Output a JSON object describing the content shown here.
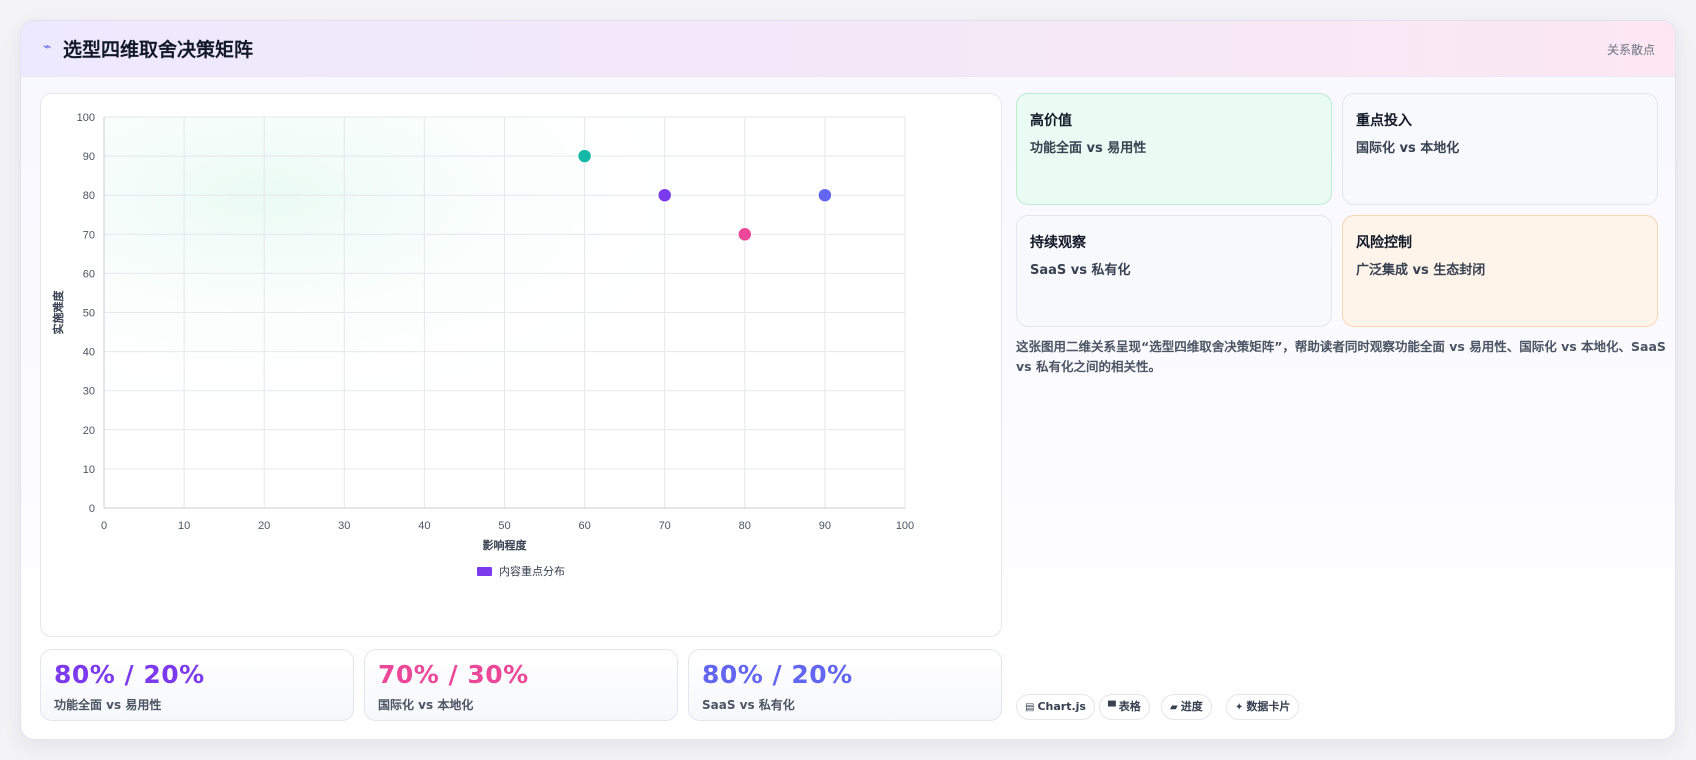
{
  "header": {
    "icon": "lightning-icon",
    "icon_glyph": "⌁",
    "title": "选型四维取舍决策矩阵",
    "tag": "关系散点"
  },
  "chart_data": {
    "type": "scatter",
    "xlabel": "影响程度",
    "ylabel": "实施难度",
    "xlim": [
      0,
      100
    ],
    "ylim": [
      0,
      100
    ],
    "xticks": [
      0,
      10,
      20,
      30,
      40,
      50,
      60,
      70,
      80,
      90,
      100
    ],
    "yticks": [
      0,
      10,
      20,
      30,
      40,
      50,
      60,
      70,
      80,
      90,
      100
    ],
    "grid": true,
    "legend": {
      "position": "bottom",
      "label": "内容重点分布",
      "color": "#7c3aed"
    },
    "series": [
      {
        "name": "内容重点分布",
        "points": [
          {
            "x": 60,
            "y": 90,
            "color": "#14b8a6"
          },
          {
            "x": 70,
            "y": 80,
            "color": "#7c3aed"
          },
          {
            "x": 80,
            "y": 70,
            "color": "#ec4899"
          },
          {
            "x": 90,
            "y": 80,
            "color": "#6366f1"
          }
        ]
      }
    ]
  },
  "stats": [
    {
      "value": "80% / 20%",
      "label": "功能全面 vs 易用性",
      "color": "#7c3aed"
    },
    {
      "value": "70% / 30%",
      "label": "国际化 vs 本地化",
      "color": "#ec4899"
    },
    {
      "value": "80% / 20%",
      "label": "SaaS vs 私有化",
      "color": "#6366f1"
    }
  ],
  "quadrants": [
    {
      "title": "高价值",
      "subtitle": "功能全面 vs 易用性",
      "bg": "#e9fbf2",
      "border": "#bdebd3"
    },
    {
      "title": "重点投入",
      "subtitle": "国际化 vs 本地化",
      "bg": "#f8f9fc",
      "border": "#e3e6ef"
    },
    {
      "title": "持续观察",
      "subtitle": "SaaS vs 私有化",
      "bg": "#f8f9fc",
      "border": "#e3e6ef"
    },
    {
      "title": "风险控制",
      "subtitle": "广泛集成 vs 生态封闭",
      "bg": "#fff4ea",
      "border": "#f5d6b4"
    }
  ],
  "description": "这张图用二维关系呈现“选型四维取舍决策矩阵”，帮助读者同时观察功能全面 vs 易用性、国际化 vs 本地化、SaaS vs 私有化之间的相关性。",
  "chips": [
    {
      "icon": "chart-icon",
      "glyph": "▤",
      "label": "Chart.js"
    },
    {
      "icon": "table-icon",
      "glyph": "▀",
      "label": "表格"
    },
    {
      "icon": "progress-icon",
      "glyph": "▰",
      "label": "进度"
    },
    {
      "icon": "sparkle-icon",
      "glyph": "✦",
      "label": "数据卡片"
    }
  ]
}
